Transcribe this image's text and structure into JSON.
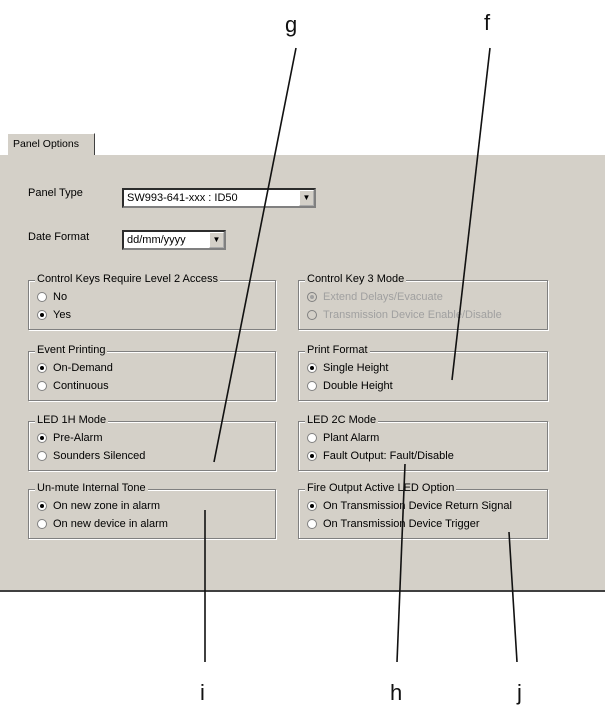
{
  "callouts": {
    "g": "g",
    "f": "f",
    "i": "i",
    "h": "h",
    "j": "j"
  },
  "tab": {
    "label": "Panel Options"
  },
  "panel_type": {
    "label": "Panel Type",
    "value": "SW993-641-xxx : ID50"
  },
  "date_format": {
    "label": "Date Format",
    "value": "dd/mm/yyyy"
  },
  "groups": {
    "control_keys": {
      "title": "Control Keys Require Level 2 Access",
      "options": [
        "No",
        "Yes"
      ]
    },
    "control_key3": {
      "title": "Control Key 3 Mode",
      "options": [
        "Extend Delays/Evacuate",
        "Transmission Device Enable/Disable"
      ]
    },
    "event_printing": {
      "title": "Event Printing",
      "options": [
        "On-Demand",
        "Continuous"
      ]
    },
    "print_format": {
      "title": "Print Format",
      "options": [
        "Single Height",
        "Double Height"
      ]
    },
    "led_1h": {
      "title": "LED 1H Mode",
      "options": [
        "Pre-Alarm",
        "Sounders Silenced"
      ]
    },
    "led_2c": {
      "title": "LED 2C Mode",
      "options": [
        "Plant Alarm",
        "Fault Output: Fault/Disable"
      ]
    },
    "unmute": {
      "title": "Un-mute Internal Tone",
      "options": [
        "On new zone in alarm",
        "On new device in alarm"
      ]
    },
    "fire_output": {
      "title": "Fire Output Active LED Option",
      "options": [
        "On Transmission Device Return Signal",
        "On Transmission Device Trigger"
      ]
    }
  }
}
